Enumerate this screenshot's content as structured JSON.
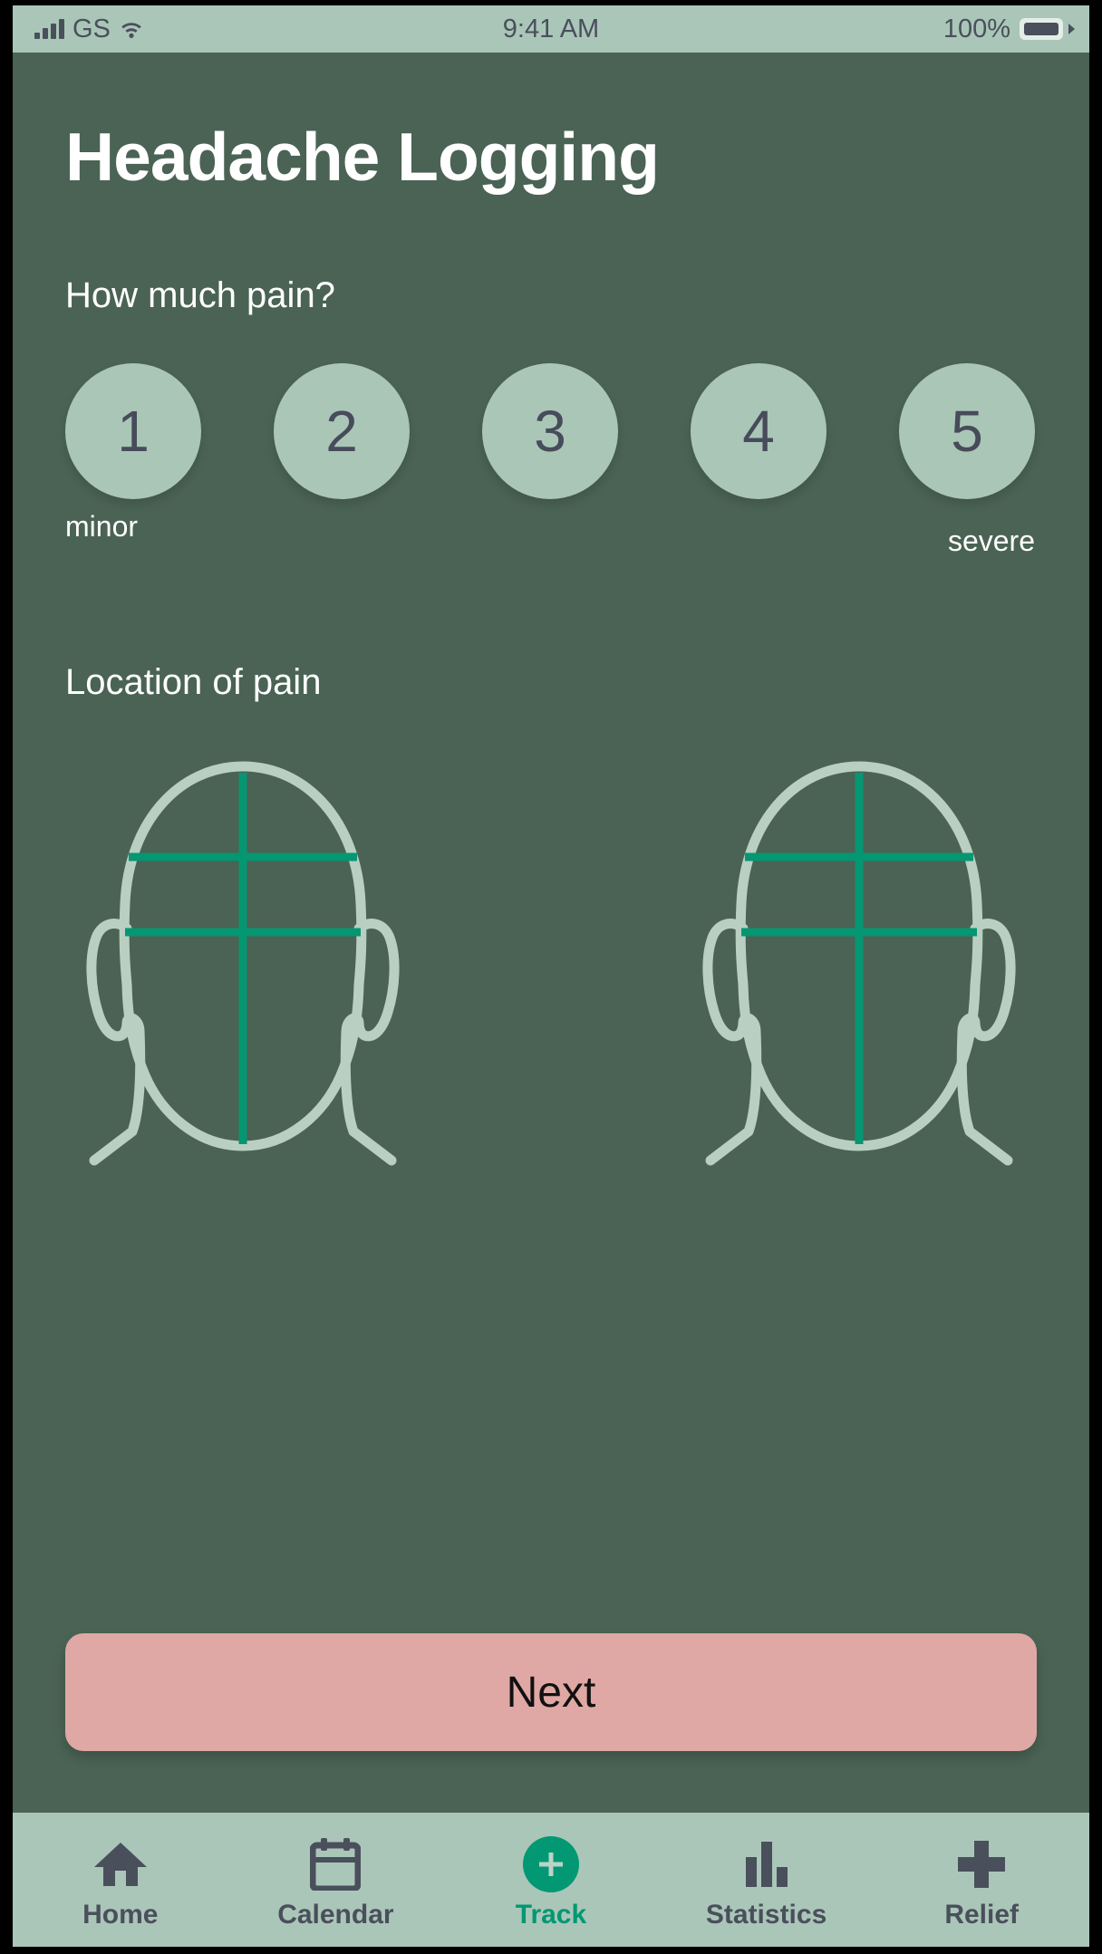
{
  "status_bar": {
    "carrier": "GS",
    "signal_icon": "signal-bars-icon",
    "wifi_icon": "wifi-icon",
    "time": "9:41 AM",
    "battery_percent": "100%",
    "battery_icon": "battery-full-icon"
  },
  "header": {
    "title": "Headache Logging"
  },
  "pain": {
    "question": "How much pain?",
    "options": [
      {
        "value": "1"
      },
      {
        "value": "2"
      },
      {
        "value": "3"
      },
      {
        "value": "4"
      },
      {
        "value": "5"
      }
    ],
    "min_label": "minor",
    "max_label": "severe"
  },
  "location": {
    "label": "Location of pain",
    "diagrams": [
      {
        "name": "head-front-left",
        "grid": "crosshair"
      },
      {
        "name": "head-front-right",
        "grid": "crosshair"
      }
    ]
  },
  "actions": {
    "next_label": "Next"
  },
  "tabbar": {
    "items": [
      {
        "label": "Home",
        "icon": "home-icon",
        "active": false
      },
      {
        "label": "Calendar",
        "icon": "calendar-icon",
        "active": false
      },
      {
        "label": "Track",
        "icon": "plus-circle-icon",
        "active": true
      },
      {
        "label": "Statistics",
        "icon": "bar-chart-icon",
        "active": false
      },
      {
        "label": "Relief",
        "icon": "plus-cross-icon",
        "active": false
      }
    ]
  },
  "colors": {
    "background": "#4a6354",
    "surface_light": "#aac6b8",
    "circle_fill": "#a9c6b6",
    "text_dark": "#474b5a",
    "accent_green": "#019873",
    "grid_line": "#059672",
    "head_outline": "#b9cfc2",
    "button_pink": "#dfa8a4",
    "text_light": "#ffffff"
  }
}
